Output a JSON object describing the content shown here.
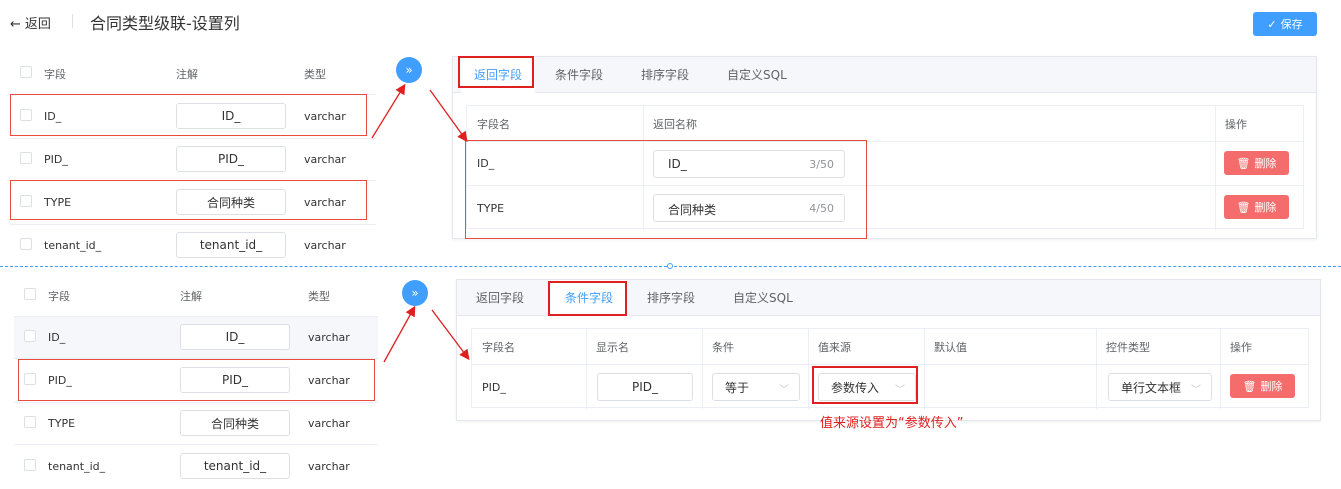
{
  "header": {
    "back_label": "返回",
    "title": "合同类型级联-设置列",
    "save_label": "保存"
  },
  "top_left_table": {
    "columns": [
      "字段",
      "注解",
      "类型"
    ],
    "rows": [
      {
        "field": "ID_",
        "comment": "ID_",
        "type": "varchar"
      },
      {
        "field": "PID_",
        "comment": "PID_",
        "type": "varchar"
      },
      {
        "field": "TYPE",
        "comment": "合同种类",
        "type": "varchar"
      },
      {
        "field": "tenant_id_",
        "comment": "tenant_id_",
        "type": "varchar"
      }
    ]
  },
  "bottom_left_table": {
    "columns": [
      "字段",
      "注解",
      "类型"
    ],
    "rows": [
      {
        "field": "ID_",
        "comment": "ID_",
        "type": "varchar"
      },
      {
        "field": "PID_",
        "comment": "PID_",
        "type": "varchar"
      },
      {
        "field": "TYPE",
        "comment": "合同种类",
        "type": "varchar"
      },
      {
        "field": "tenant_id_",
        "comment": "tenant_id_",
        "type": "varchar"
      }
    ]
  },
  "move_button_label": "»",
  "tabs": [
    "返回字段",
    "条件字段",
    "排序字段",
    "自定义SQL"
  ],
  "return_fields": {
    "columns": [
      "字段名",
      "返回名称",
      "操作"
    ],
    "rows": [
      {
        "field": "ID_",
        "name": "ID_",
        "count": "3/50",
        "delete": "删除"
      },
      {
        "field": "TYPE",
        "name": "合同种类",
        "count": "4/50",
        "delete": "删除"
      }
    ]
  },
  "condition_fields": {
    "columns": [
      "字段名",
      "显示名",
      "条件",
      "值来源",
      "默认值",
      "控件类型",
      "操作"
    ],
    "rows": [
      {
        "field": "PID_",
        "display": "PID_",
        "condition": "等于",
        "source": "参数传入",
        "default": "",
        "control": "单行文本框",
        "delete": "删除"
      }
    ]
  },
  "annotation_note": "值来源设置为“参数传入”",
  "colors": {
    "accent": "#409eff",
    "danger": "#f56c6c",
    "annotation": "#e02020"
  }
}
